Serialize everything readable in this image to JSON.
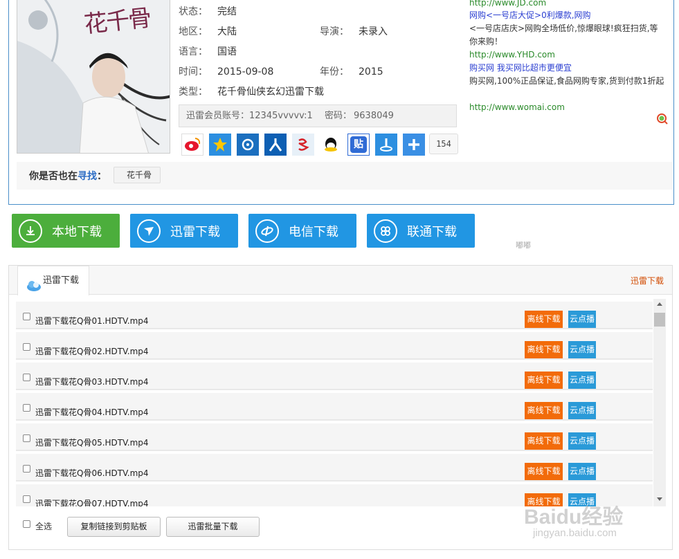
{
  "meta": {
    "status_label": "状态：",
    "status_value": "完结",
    "region_label": "地区：",
    "region_value": "大陆",
    "director_label": "导演：",
    "director_value": "未录入",
    "language_label": "语言：",
    "language_value": "国语",
    "time_label": "时间：",
    "time_value": "2015-09-08",
    "year_label": "年份：",
    "year_value": "2015",
    "type_label": "类型：",
    "type_value": "花千骨仙侠玄幻迅雷下载",
    "account_label": "迅雷会员账号：",
    "account_value": "12345vvvvv:1",
    "password_label": "密码：",
    "password_value": "9638049"
  },
  "poster": {
    "title_glyphs": "花千骨"
  },
  "share": {
    "count": "154"
  },
  "ads": [
    {
      "url": "http://www.JD.com"
    },
    {
      "title": "网购<一号店大促>0利爆款,网购",
      "desc": "<一号店店庆>网购全场低价,惊爆眼球!疯狂扫货,等你来购！",
      "url": "http://www.YHD.com"
    },
    {
      "title": "购买网 我买网比超市更便宜",
      "desc": "购买网,100%正品保证,食品网购专家,货到付款1折起",
      "url": "http://www.womai.com"
    }
  ],
  "find": {
    "prefix": "你是否也在",
    "highlight": "寻找",
    "colon": "：",
    "tag": "花千骨"
  },
  "download_buttons": [
    {
      "label": "本地下载",
      "color": "#4cae3c"
    },
    {
      "label": "迅雷下载",
      "color": "#2196e3"
    },
    {
      "label": "电信下载",
      "color": "#2196e3"
    },
    {
      "label": "联通下载",
      "color": "#2196e3"
    }
  ],
  "float_text": "嘟嘟",
  "panel": {
    "tab_label": "迅雷下载",
    "right_label": "迅雷下载",
    "files": [
      {
        "name": "迅雷下载花Q骨01.HDTV.mp4"
      },
      {
        "name": "迅雷下载花Q骨02.HDTV.mp4"
      },
      {
        "name": "迅雷下载花Q骨03.HDTV.mp4"
      },
      {
        "name": "迅雷下载花Q骨04.HDTV.mp4"
      },
      {
        "name": "迅雷下载花Q骨05.HDTV.mp4"
      },
      {
        "name": "迅雷下载花Q骨06.HDTV.mp4"
      },
      {
        "name": "迅雷下载花Q骨07.HDTV.mp4"
      }
    ],
    "offline_label": "离线下载",
    "cloud_label": "云点播",
    "select_all": "全选",
    "copy_button": "复制链接到剪贴板",
    "batch_button": "迅雷批量下载"
  },
  "watermark": {
    "brand": "Baidu经验",
    "url": "jingyan.baidu.com"
  }
}
